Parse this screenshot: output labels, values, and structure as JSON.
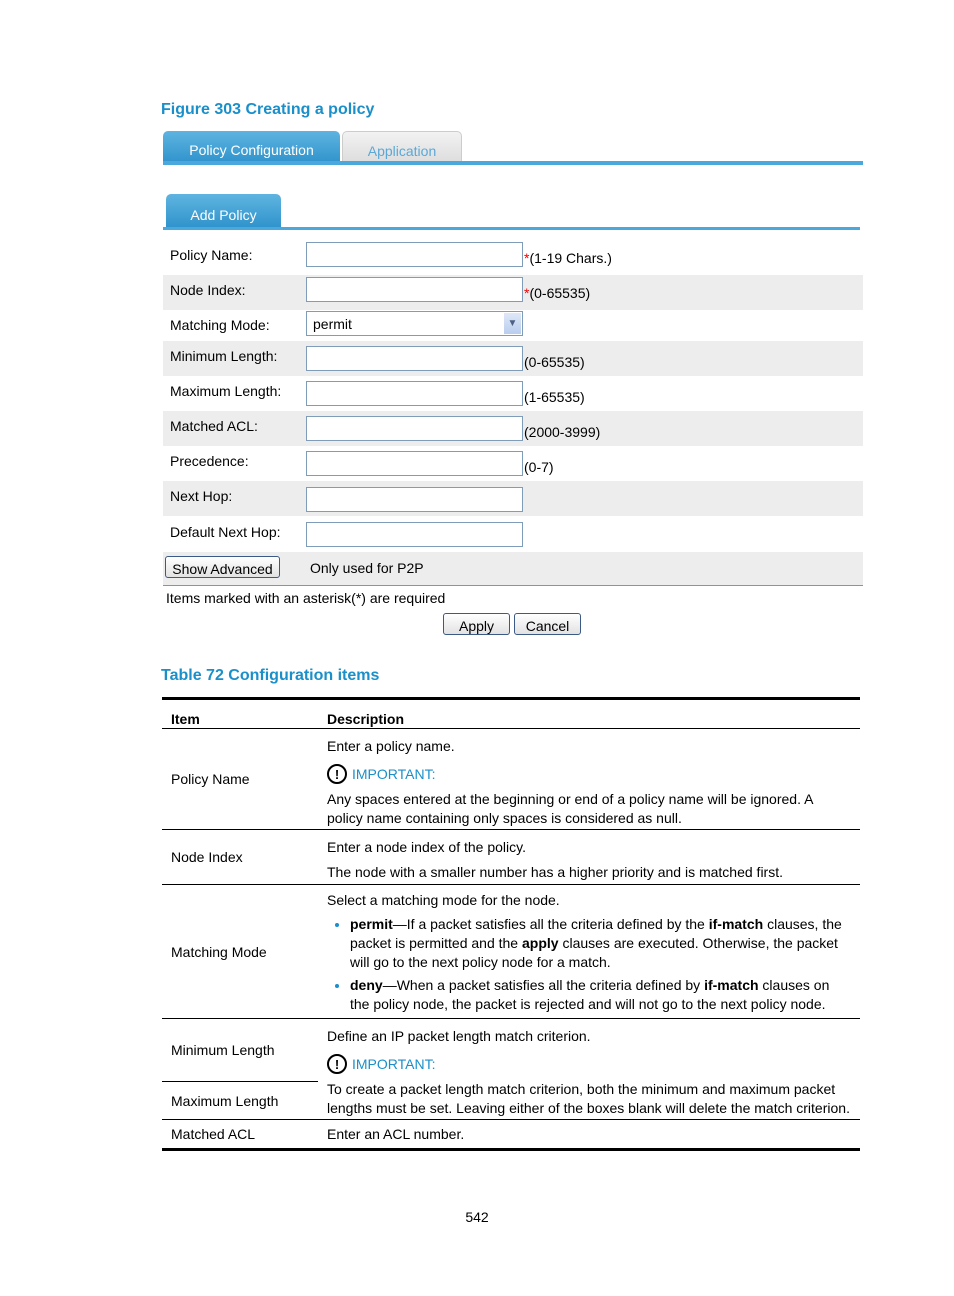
{
  "figure_caption": "Figure 303 Creating a policy",
  "tabs": [
    {
      "label": "Policy Configuration",
      "active": true
    },
    {
      "label": "Application",
      "active": false
    }
  ],
  "subtab": "Add Policy",
  "form": {
    "rows": [
      {
        "label": "Policy Name:",
        "value": "",
        "hint": "(1-19 Chars.)",
        "required": "*"
      },
      {
        "label": "Node Index:",
        "value": "",
        "hint": "(0-65535)",
        "required": "*"
      },
      {
        "label": "Matching Mode:",
        "value": "permit"
      },
      {
        "label": "Minimum Length:",
        "value": "",
        "hint": "(0-65535)"
      },
      {
        "label": "Maximum Length:",
        "value": "",
        "hint": "(1-65535)"
      },
      {
        "label": "Matched ACL:",
        "value": "",
        "hint": "(2000-3999)"
      },
      {
        "label": "Precedence:",
        "value": "",
        "hint": "(0-7)"
      },
      {
        "label": "Next Hop:",
        "value": ""
      },
      {
        "label": "Default Next Hop:",
        "value": ""
      }
    ],
    "show_advanced": "Show Advanced",
    "p2p_note": "Only used for P2P",
    "required_note": "Items marked with an asterisk(*) are required",
    "apply": "Apply",
    "cancel": "Cancel"
  },
  "table_caption": "Table 72 Configuration items",
  "table": {
    "headers": [
      "Item",
      "Description"
    ],
    "important": "IMPORTANT:",
    "policy_name": {
      "item": "Policy Name",
      "d1": "Enter a policy name.",
      "d2": "Any spaces entered at the beginning or end of a policy name will be ignored. A policy name containing only spaces is considered as null."
    },
    "node_index": {
      "item": "Node Index",
      "d1": "Enter a node index of the policy.",
      "d2": "The node with a smaller number has a higher priority and is matched first."
    },
    "matching_mode": {
      "item": "Matching Mode",
      "d1": "Select a matching mode for the node.",
      "b1_term": "permit",
      "b1_a": "—If a packet satisfies all the criteria defined by the ",
      "b1_kw1": "if-match",
      "b1_b": " clauses, the packet is permitted and the ",
      "b1_kw2": "apply",
      "b1_c": " clauses are executed. Otherwise, the packet will go to the next policy node for a match.",
      "b2_term": "deny",
      "b2_a": "—When a packet satisfies all the criteria defined by ",
      "b2_kw1": "if-match",
      "b2_b": " clauses on the policy node, the packet is rejected and will not go to the next policy node."
    },
    "min_length": {
      "item": "Minimum Length",
      "d1": "Define an IP packet length match criterion."
    },
    "max_length": {
      "item": "Maximum Length",
      "d2": "To create a packet length match criterion, both the minimum and maximum packet lengths must be set. Leaving either of the boxes blank will delete the match criterion."
    },
    "matched_acl": {
      "item": "Matched ACL",
      "d1": "Enter an ACL number."
    }
  },
  "page_number": "542"
}
